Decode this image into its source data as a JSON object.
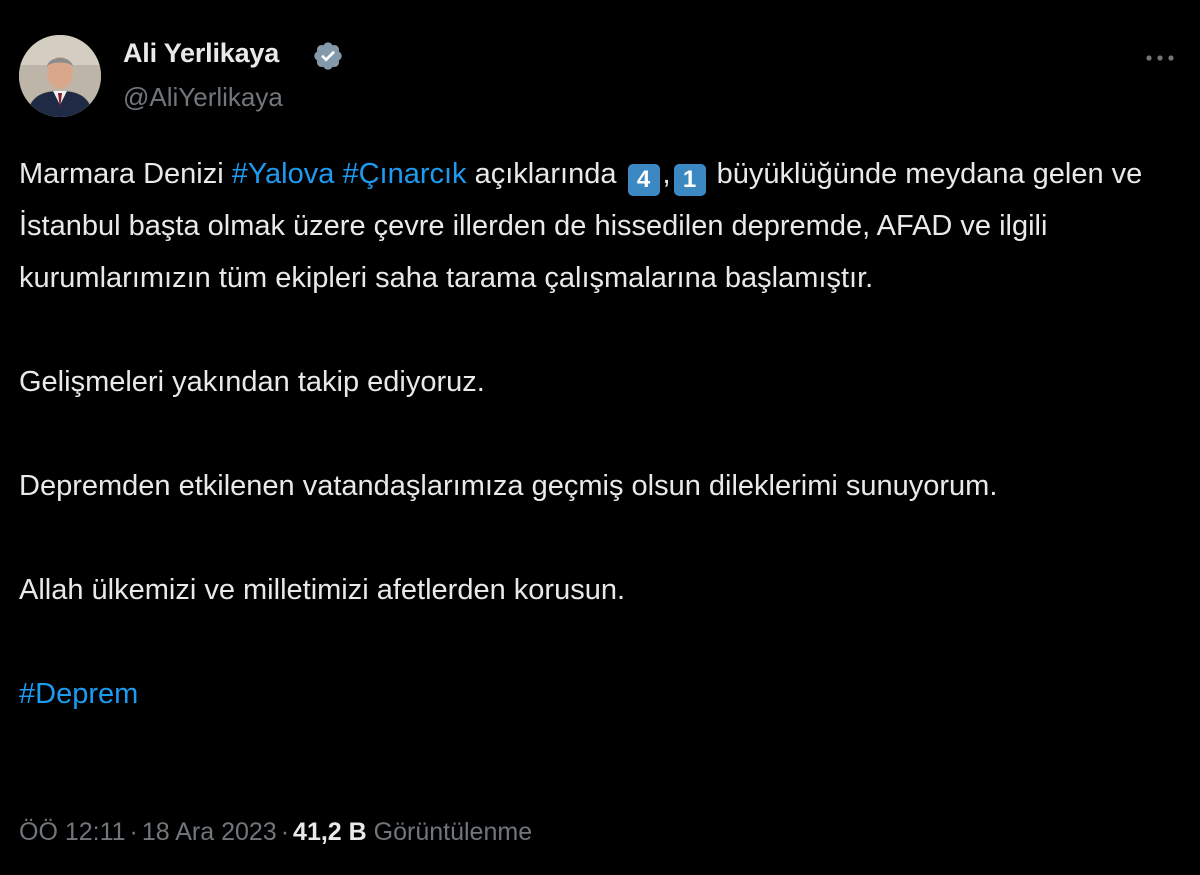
{
  "author": {
    "name": "Ali Yerlikaya",
    "handle": "@AliYerlikaya",
    "verified": true
  },
  "menu": {
    "icon": "more-horizontal-icon"
  },
  "tweet": {
    "p1_part1": "Marmara Denizi ",
    "hashtag_yalova": "#Yalova",
    "space1": " ",
    "hashtag_cinarcik": "#Çınarcık",
    "p1_part2": " açıklarında ",
    "keycap_4": "4",
    "comma": ",",
    "keycap_1": "1",
    "p1_part3": " büyüklüğünde meydana gelen ve İstanbul başta olmak üzere çevre illerden de hissedilen depremde, AFAD ve ilgili kurumlarımızın tüm ekipleri saha tarama çalışmalarına başlamıştır.",
    "p2": "Gelişmeleri yakından takip ediyoruz.",
    "p3": "Depremden etkilenen vatandaşlarımıza geçmiş olsun dileklerimi sunuyorum.",
    "p4": "Allah ülkemizi ve milletimizi afetlerden korusun.",
    "hashtag_deprem": "#Deprem"
  },
  "meta": {
    "time": "ÖÖ 12:11",
    "separator": "·",
    "date": "18 Ara 2023",
    "views_count": "41,2 B",
    "views_label": "Görüntülenme"
  },
  "colors": {
    "background": "#000000",
    "text": "#e7e9ea",
    "secondary": "#71767b",
    "link": "#1d9bf0",
    "keycap": "#3b88c3"
  }
}
